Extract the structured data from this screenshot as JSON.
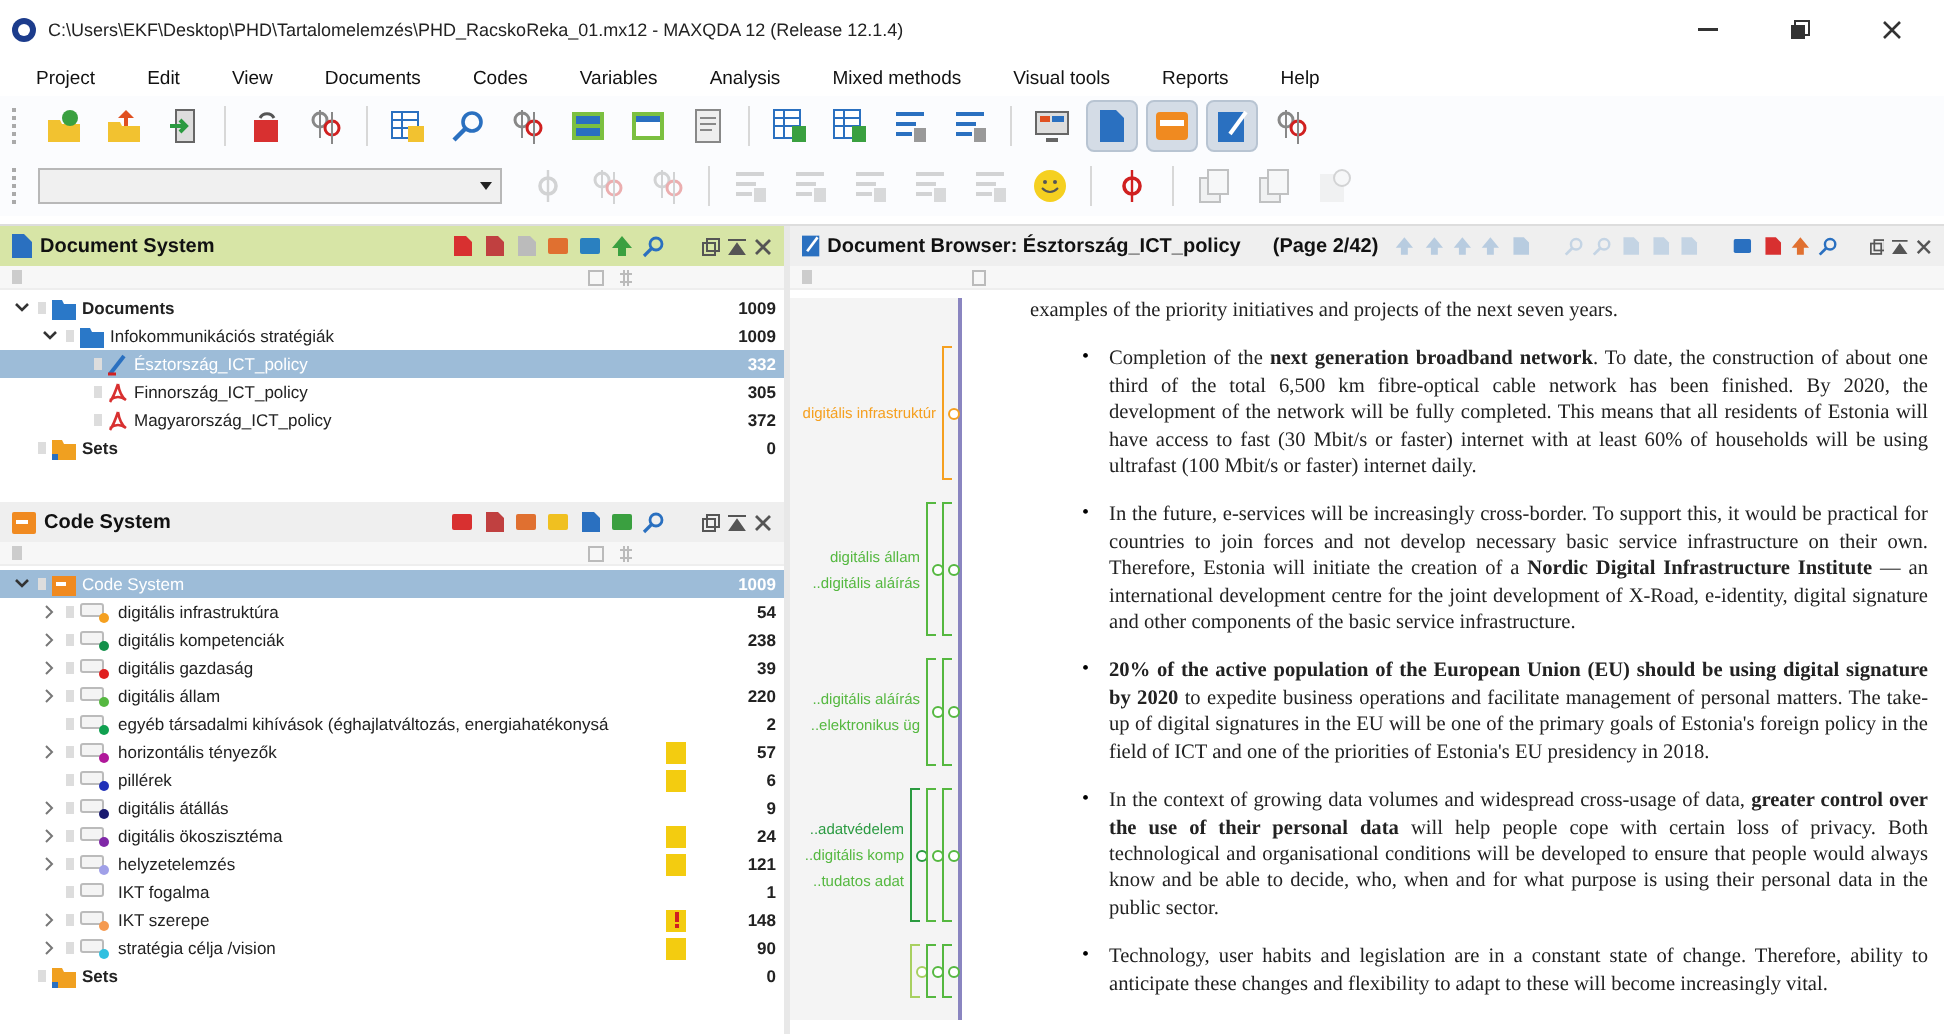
{
  "window": {
    "title": "C:\\Users\\EKF\\Desktop\\PHD\\Tartalomelemzés\\PHD_RacskoReka_01.mx12 - MAXQDA 12  (Release 12.1.4)"
  },
  "menu": [
    "Project",
    "Edit",
    "View",
    "Documents",
    "Codes",
    "Variables",
    "Analysis",
    "Mixed methods",
    "Visual tools",
    "Reports",
    "Help"
  ],
  "toolbar": [
    {
      "kind": "newfolder",
      "selected": false
    },
    {
      "kind": "openfolder",
      "selected": false
    },
    {
      "kind": "import",
      "selected": false
    },
    {
      "kind": "separator"
    },
    {
      "kind": "reload",
      "selected": false
    },
    {
      "kind": "pins",
      "selected": false
    },
    {
      "kind": "separator"
    },
    {
      "kind": "table",
      "selected": false
    },
    {
      "kind": "search",
      "selected": false
    },
    {
      "kind": "pins",
      "selected": false
    },
    {
      "kind": "grid",
      "selected": false
    },
    {
      "kind": "window",
      "selected": false
    },
    {
      "kind": "report",
      "selected": false
    },
    {
      "kind": "separator"
    },
    {
      "kind": "sheet",
      "selected": false
    },
    {
      "kind": "sheet",
      "selected": false
    },
    {
      "kind": "lines",
      "selected": false
    },
    {
      "kind": "lines",
      "selected": false
    },
    {
      "kind": "separator"
    },
    {
      "kind": "monitor",
      "selected": false
    },
    {
      "kind": "document",
      "selected": true
    },
    {
      "kind": "codewin",
      "selected": true
    },
    {
      "kind": "pen",
      "selected": true
    },
    {
      "kind": "pins",
      "selected": false
    }
  ],
  "toolbar2": [
    {
      "kind": "pin",
      "disabled": true
    },
    {
      "kind": "pins",
      "disabled": true
    },
    {
      "kind": "pins",
      "disabled": true
    },
    {
      "kind": "separator"
    },
    {
      "kind": "lines",
      "disabled": true
    },
    {
      "kind": "lines",
      "disabled": true
    },
    {
      "kind": "lines",
      "disabled": true
    },
    {
      "kind": "lines",
      "disabled": true
    },
    {
      "kind": "lines",
      "disabled": true
    },
    {
      "kind": "smiley",
      "disabled": false
    },
    {
      "kind": "separator"
    },
    {
      "kind": "pin",
      "disabled": false
    },
    {
      "kind": "separator"
    },
    {
      "kind": "stack",
      "disabled": true
    },
    {
      "kind": "stack",
      "disabled": true
    },
    {
      "kind": "page",
      "disabled": true
    }
  ],
  "document_system": {
    "title": "Document System",
    "tree": [
      {
        "label": "Documents",
        "count": "1009",
        "kind": "folder",
        "selected": false,
        "expanded": true,
        "children": [
          {
            "label": "Infokommunikációs stratégiák",
            "count": "1009",
            "kind": "folder",
            "selected": false,
            "expanded": true,
            "children": [
              {
                "label": "Észtország_ICT_policy",
                "count": "332",
                "kind": "textdoc",
                "selected": true
              },
              {
                "label": "Finnország_ICT_policy",
                "count": "305",
                "kind": "pdf",
                "selected": false
              },
              {
                "label": "Magyarország_ICT_policy",
                "count": "372",
                "kind": "pdf",
                "selected": false
              }
            ]
          }
        ]
      },
      {
        "label": "Sets",
        "count": "0",
        "kind": "sets",
        "selected": false
      }
    ]
  },
  "code_system": {
    "title": "Code System",
    "tree": [
      {
        "label": "Code System",
        "count": "1009",
        "kind": "codefolder",
        "selected": true,
        "expanded": true,
        "children": [
          {
            "label": "digitális infrastruktúra",
            "count": "54",
            "kind": "code",
            "color": "#f5a020",
            "selected": false,
            "expanded": false
          },
          {
            "label": "digitális kompetenciák",
            "count": "238",
            "kind": "code",
            "color": "#13904a",
            "selected": false,
            "expanded": false
          },
          {
            "label": "digitális gazdaság",
            "count": "39",
            "kind": "code",
            "color": "#e02020",
            "selected": false,
            "expanded": false
          },
          {
            "label": "digitális állam",
            "count": "220",
            "kind": "code",
            "color": "#55b840",
            "selected": false,
            "expanded": false
          },
          {
            "label": "egyéb társadalmi kihívások (éghajlatváltozás, energiahatékonysá",
            "count": "2",
            "kind": "code",
            "color": "#10a050",
            "selected": false
          },
          {
            "label": "horizontális tényezők",
            "count": "57",
            "kind": "code",
            "color": "#b0189a",
            "selected": false,
            "expanded": false,
            "memo": {
              "kind": "note"
            }
          },
          {
            "label": "pillérek",
            "count": "6",
            "kind": "code",
            "color": "#2030b8",
            "selected": false,
            "memo": {
              "kind": "note"
            }
          },
          {
            "label": "digitális átállás",
            "count": "9",
            "kind": "code",
            "color": "#1a1a70",
            "selected": false,
            "expanded": false
          },
          {
            "label": "digitális ökoszisztéma",
            "count": "24",
            "kind": "code",
            "color": "#8028a8",
            "selected": false,
            "expanded": false,
            "memo": {
              "kind": "note"
            }
          },
          {
            "label": "helyzetelemzés",
            "count": "121",
            "kind": "code",
            "color": "#a0a0e8",
            "selected": false,
            "expanded": false,
            "memo": {
              "kind": "note"
            }
          },
          {
            "label": "IKT fogalma",
            "count": "1",
            "kind": "code",
            "selected": false
          },
          {
            "label": "IKT szerepe",
            "count": "148",
            "kind": "code",
            "color": "#f59a50",
            "selected": false,
            "expanded": false,
            "memo": {
              "kind": "alert"
            }
          },
          {
            "label": "stratégia célja /vision",
            "count": "90",
            "kind": "code",
            "color": "#30c0e0",
            "selected": false,
            "expanded": false,
            "memo": {
              "kind": "note"
            }
          }
        ]
      },
      {
        "label": "Sets",
        "count": "0",
        "kind": "sets",
        "selected": false
      }
    ]
  },
  "document_browser": {
    "title": "Document Browser: Észtország_ICT_policy",
    "page": "(Page 2/42)",
    "paragraphs": [
      {
        "text": "examples of the priority initiatives and projects of the next seven years."
      },
      {
        "bullet": "•",
        "text": "Completion of the **next generation broadband network**. To date, the construction of about one third of the total 6,500 km fibre-optical cable network has been finished. By 2020, the development of the network will be fully completed. This means that all residents of Estonia will have access to fast (30 Mbit/s or faster) internet with at least 60% of households will be using ultrafast (100 Mbit/s or faster) internet daily.",
        "codes": [
          {
            "label": "digitális infrastruktúr",
            "color": "#f5a020"
          }
        ]
      },
      {
        "bullet": "•",
        "text": "In the future, e-services will be increasingly cross-border. To support this, it would be practical for countries to join forces and not develop necessary basic service infrastructure on their own. Therefore, Estonia will initiate the creation of a **Nordic Digital Infrastructure Institute** — an international development centre for the joint development of X-Road, e-identity, digital signature and other components of the basic service infrastructure.",
        "codes": [
          {
            "label": "digitális állam",
            "color": "#55b840"
          },
          {
            "label": "..digitális aláírás",
            "color": "#55b840"
          }
        ]
      },
      {
        "bullet": "•",
        "text": "**20% of the active population of the European Union (EU) should be using digital signature by 2020** to expedite business operations and facilitate management of personal matters. The take-up of digital signatures in the EU will be one of the primary goals of Estonia's foreign policy in the field of ICT and one of the priorities of Estonia's EU presidency in 2018.",
        "codes": [
          {
            "label": "..digitális aláírás",
            "color": "#55b840"
          },
          {
            "label": "..elektronikus üg",
            "color": "#55b840"
          }
        ]
      },
      {
        "bullet": "•",
        "text": "In the context of growing data volumes and widespread cross-usage of data, **greater control over the use of their personal data** will help people cope with certain loss of privacy. Both technological and organisational conditions will be developed to ensure that people would always know and be able to decide, who, when and for what purpose is using their personal data in the public sector.",
        "codes": [
          {
            "label": "..adatvédelem",
            "color": "#2a9a40"
          },
          {
            "label": "..digitális komp",
            "color": "#55b840"
          },
          {
            "label": "..tudatos adat",
            "color": "#55b840"
          }
        ]
      },
      {
        "bullet": "•",
        "text": "Technology, user habits and legislation are in a constant state of change. Therefore, ability to anticipate these changes and flexibility to adapt to these will become increasingly vital.",
        "codes": [
          {
            "color": "#a8d060"
          },
          {
            "color": "#55b840"
          },
          {
            "color": "#55b840"
          }
        ]
      }
    ]
  }
}
